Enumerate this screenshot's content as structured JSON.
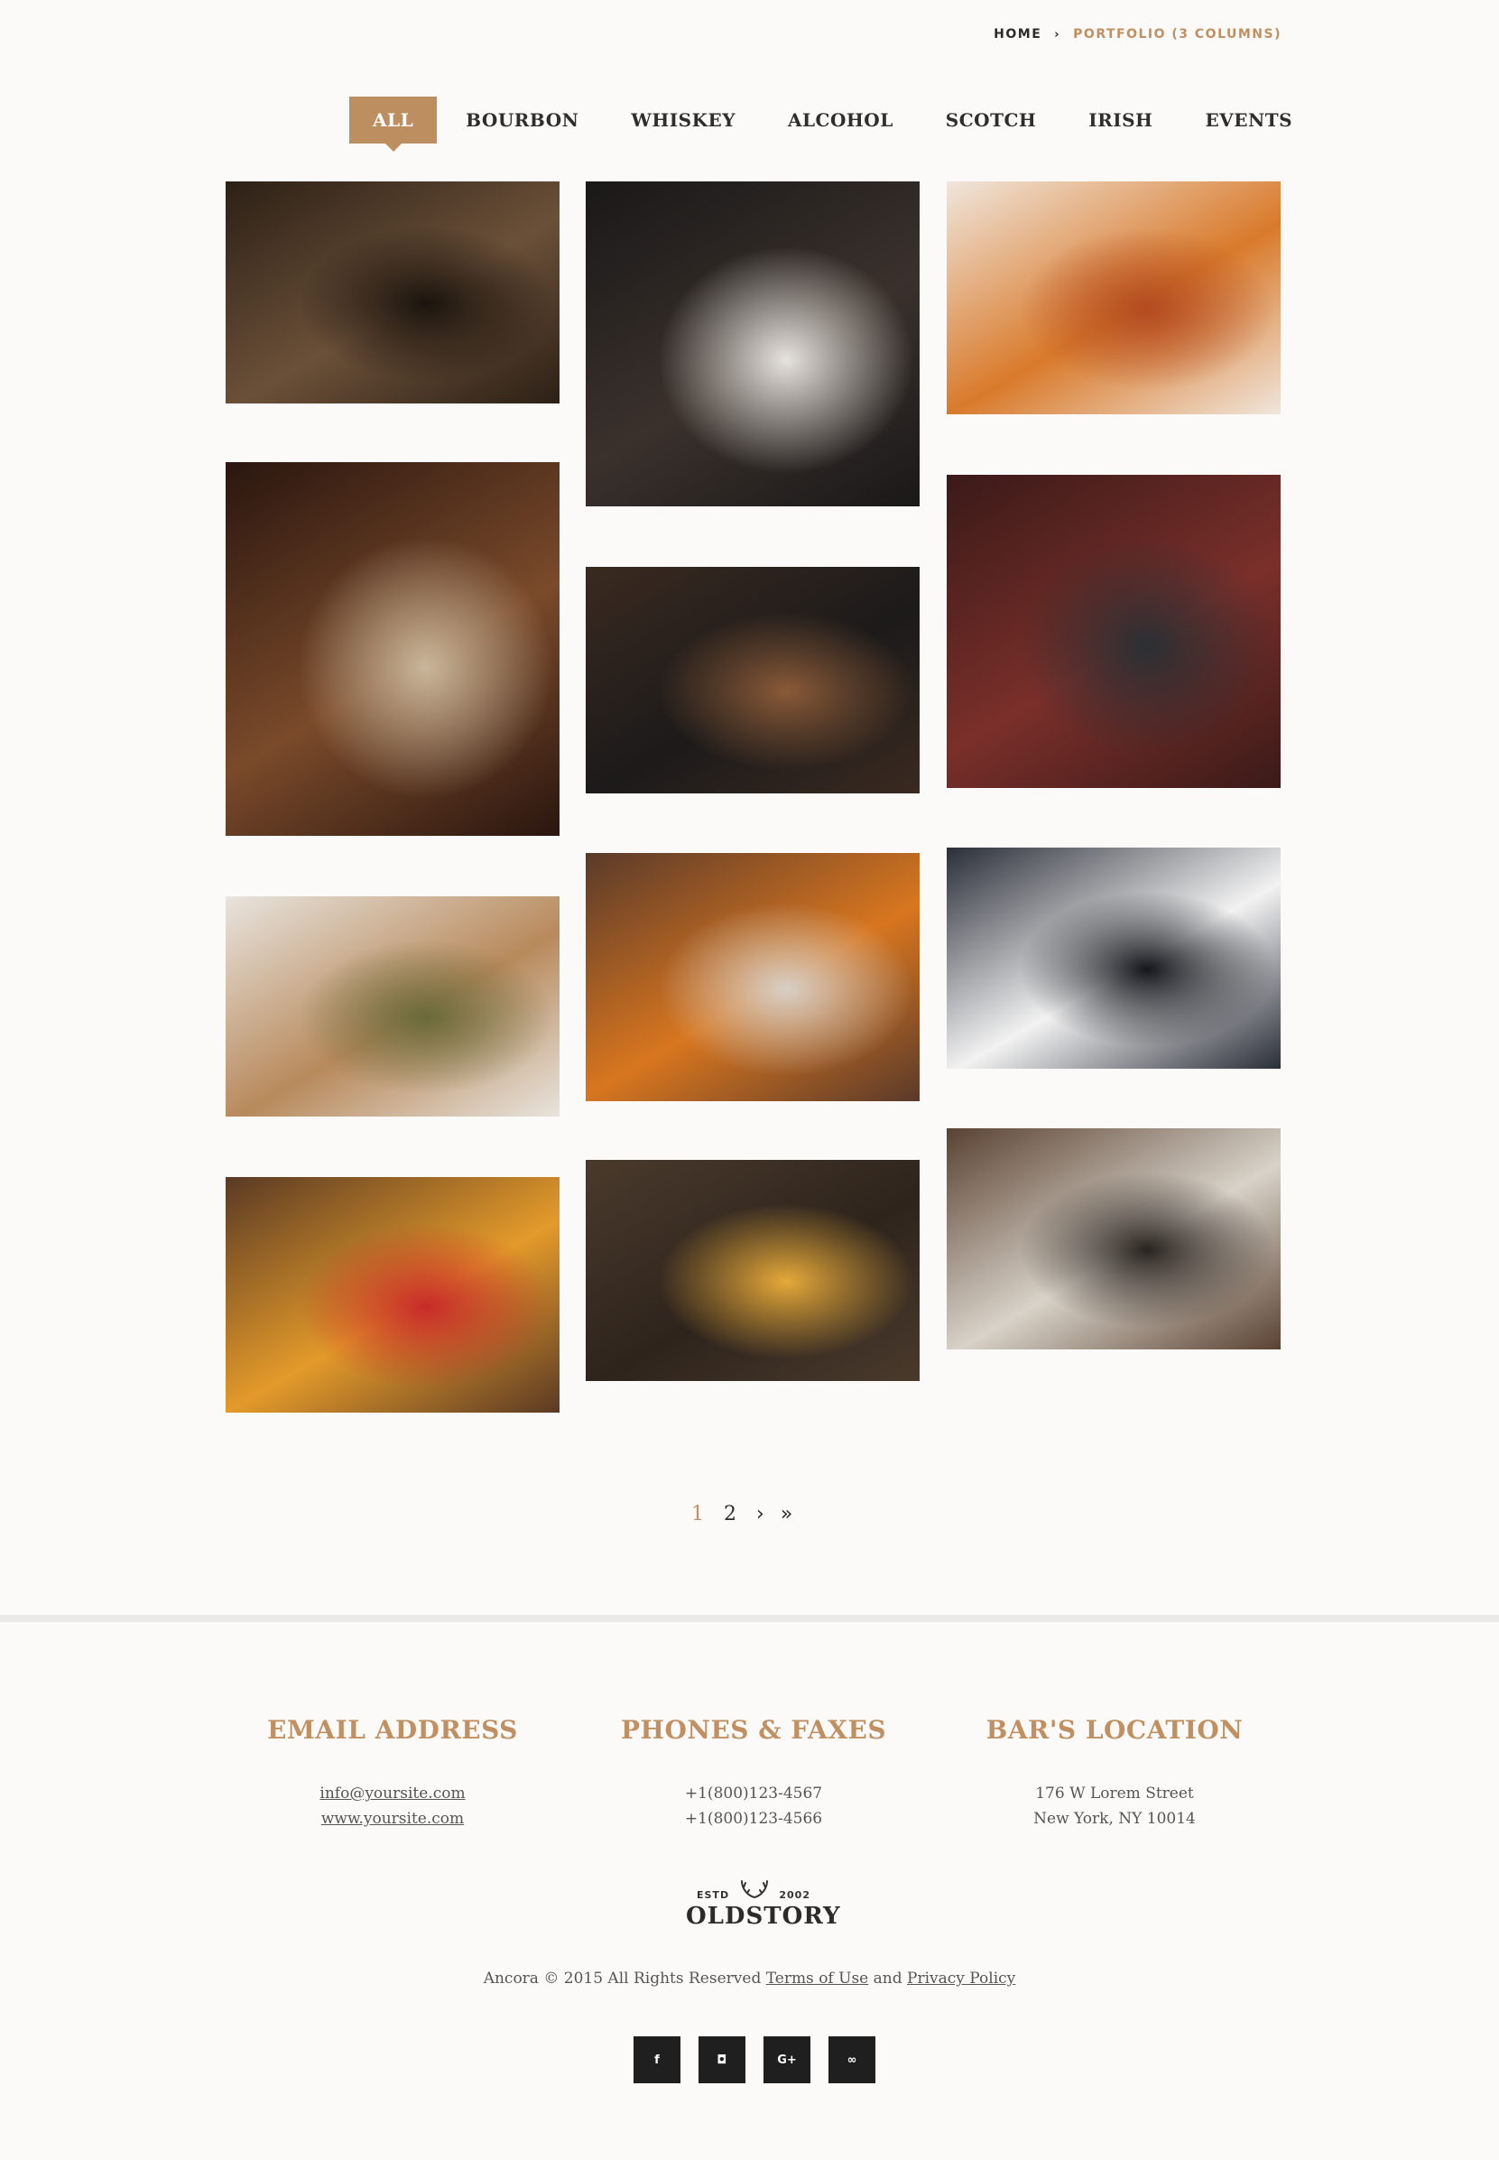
{
  "breadcrumb": {
    "home": "HOME",
    "separator_icon": "chevron-right-icon",
    "current": "PORTFOLIO (3 COLUMNS)"
  },
  "filters": [
    "ALL",
    "BOURBON",
    "WHISKEY",
    "ALCOHOL",
    "SCOTCH",
    "IRISH",
    "EVENTS"
  ],
  "active_filter": "ALL",
  "gallery": [
    {
      "name": "bar-interior-photo",
      "colors": [
        "#2c2016",
        "#6b5038",
        "#1b140e"
      ]
    },
    {
      "name": "bearded-man-photo",
      "colors": [
        "#1a1818",
        "#3a312c",
        "#e6e2dd"
      ]
    },
    {
      "name": "orange-cocktail-photo",
      "colors": [
        "#f0e6dc",
        "#d97a2b",
        "#b34b20"
      ]
    },
    {
      "name": "pouring-cocktail-photo",
      "colors": [
        "#2a160f",
        "#7a4a2a",
        "#c9b69a"
      ]
    },
    {
      "name": "whiskey-on-bar-mat-photo",
      "colors": [
        "#3a2a20",
        "#1c1a1a",
        "#8a5a38"
      ]
    },
    {
      "name": "red-pub-interior-photo",
      "colors": [
        "#3a1a18",
        "#7a2f2a",
        "#2a2f33"
      ]
    },
    {
      "name": "pickles-jar-photo",
      "colors": [
        "#e8e4de",
        "#b88a5c",
        "#6a6a3a"
      ]
    },
    {
      "name": "old-fashioned-glass-photo",
      "colors": [
        "#5a3a2a",
        "#d8761f",
        "#d6cfc7"
      ]
    },
    {
      "name": "bartender-pouring-photo",
      "colors": [
        "#2a2e38",
        "#f2f2f2",
        "#14161c"
      ]
    },
    {
      "name": "cherry-cocktail-photo",
      "colors": [
        "#5a3a24",
        "#e39a2a",
        "#c82a2a"
      ]
    },
    {
      "name": "two-whiskey-glasses-photo",
      "colors": [
        "#4a3a2c",
        "#2e241c",
        "#e6a93a"
      ]
    },
    {
      "name": "crystal-glasses-photo",
      "colors": [
        "#5a4232",
        "#d8d2c8",
        "#2a2420"
      ]
    }
  ],
  "pagination": {
    "pages": [
      "1",
      "2"
    ],
    "current": "1",
    "next_icon": "›",
    "last_icon": "»"
  },
  "footer": {
    "email": {
      "title": "EMAIL ADDRESS",
      "lines": [
        "info@yoursite.com",
        "www.yoursite.com"
      ]
    },
    "phones": {
      "title": "PHONES & FAXES",
      "lines": [
        "+1(800)123-4567",
        "+1(800)123-4566"
      ]
    },
    "location": {
      "title": "BAR'S LOCATION",
      "lines": [
        "176 W Lorem Street",
        "New York, NY 10014"
      ]
    }
  },
  "logo": {
    "estd": "ESTD",
    "year": "2002",
    "name": "OLDSTORY"
  },
  "copyright": {
    "text": "Ancora © 2015 All Rights Reserved",
    "terms": "Terms of Use",
    "and": "and",
    "privacy": "Privacy Policy"
  },
  "socials": [
    {
      "name": "facebook-icon",
      "glyph": "f"
    },
    {
      "name": "instagram-icon",
      "glyph": "◘"
    },
    {
      "name": "google-plus-icon",
      "glyph": "G+"
    },
    {
      "name": "tripadvisor-icon",
      "glyph": "∞"
    }
  ]
}
